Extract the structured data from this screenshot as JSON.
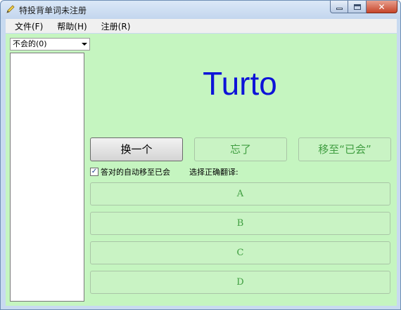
{
  "window": {
    "title": "特投背单词未注册"
  },
  "menu": {
    "items": [
      "文件(F)",
      "帮助(H)",
      "注册(R)"
    ]
  },
  "filter": {
    "selected": "不会的(0)"
  },
  "word": {
    "text": "Turto"
  },
  "actions": {
    "next_label": "换一个",
    "forgot_label": "忘了",
    "move_known_label": "移至“已会”"
  },
  "auto_move": {
    "label": "答对的自动移至已会",
    "checked": true,
    "check_glyph": "✓"
  },
  "choose_label": "选择正确翻译:",
  "options": [
    "A",
    "B",
    "C",
    "D"
  ],
  "colors": {
    "client_background": "#c5f5c0",
    "word_color": "#0d13d8",
    "option_text": "#3f9d40"
  }
}
